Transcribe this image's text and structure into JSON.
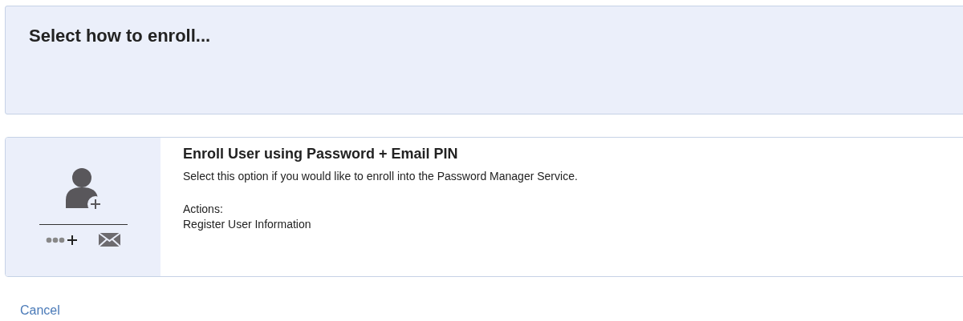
{
  "header": {
    "title": "Select how to enroll..."
  },
  "options": [
    {
      "kind": "password-email",
      "title": "Enroll User using Password + Email PIN",
      "description": "Select this option if you would like to enroll into the Password Manager Service.",
      "actions_label": "Actions:",
      "actions": [
        "Register User Information"
      ]
    }
  ],
  "cancel": "Cancel"
}
